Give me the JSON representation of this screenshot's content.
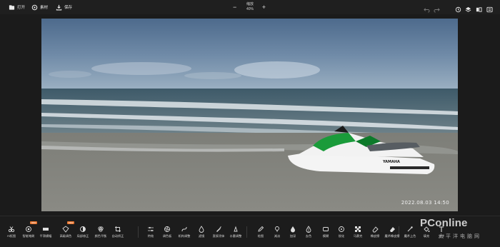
{
  "toolbar": {
    "open_label": "打开",
    "material_label": "素材",
    "save_label": "保存"
  },
  "zoom": {
    "label": "缩放",
    "value": "40%"
  },
  "canvas": {
    "timestamp": "2022.08.03 14:50",
    "jetski_brand": "YAMAHA"
  },
  "tools": [
    {
      "label": "AI抠图",
      "icon": "scissors-icon"
    },
    {
      "label": "智能笔刷",
      "icon": "brush-icon",
      "badge": "NEW"
    },
    {
      "label": "平滑横幅",
      "icon": "banner-icon"
    },
    {
      "label": "高级调色",
      "icon": "palette-icon",
      "badge": "NEW"
    },
    {
      "label": "局部修正",
      "icon": "contrast-icon"
    },
    {
      "label": "颜色平衡",
      "icon": "color-balance-icon"
    },
    {
      "label": "自动矫正",
      "icon": "crop-icon"
    },
    {
      "label": "特效",
      "icon": "sliders-icon"
    },
    {
      "label": "调色板",
      "icon": "aperture-icon"
    },
    {
      "label": "机构调整",
      "icon": "curve-icon"
    },
    {
      "label": "滤镜",
      "icon": "drop-icon"
    },
    {
      "label": "直接涂抹",
      "icon": "smudge-icon"
    },
    {
      "label": "水墨调整",
      "icon": "ink-icon"
    },
    {
      "label": "绘图",
      "icon": "pencil-icon"
    },
    {
      "label": "减淡",
      "icon": "dodge-icon"
    },
    {
      "label": "加深",
      "icon": "burn-icon"
    },
    {
      "label": "去色",
      "icon": "desaturate-icon"
    },
    {
      "label": "模糊",
      "icon": "blur-icon"
    },
    {
      "label": "锐化",
      "icon": "sharpen-icon"
    },
    {
      "label": "马赛克",
      "icon": "mosaic-icon"
    },
    {
      "label": "橡皮擦",
      "icon": "eraser-icon"
    },
    {
      "label": "魔术橡皮擦",
      "icon": "magic-eraser-icon"
    },
    {
      "label": "魔术上色",
      "icon": "magic-color-icon"
    },
    {
      "label": "填充",
      "icon": "fill-icon"
    },
    {
      "label": "文字",
      "icon": "text-icon"
    }
  ],
  "watermark": {
    "logo": "PConline",
    "chinese": "太平洋电脑网"
  },
  "colors": {
    "background": "#1b1b1b",
    "accent_badge": "#e8722a"
  }
}
